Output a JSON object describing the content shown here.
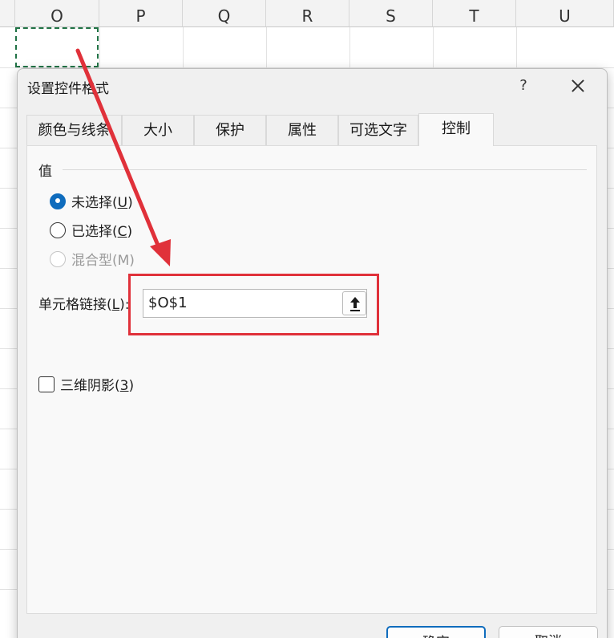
{
  "sheet": {
    "columns": [
      "O",
      "P",
      "Q",
      "R",
      "S",
      "T",
      "U"
    ]
  },
  "dialog": {
    "title": "设置控件格式",
    "help_label": "?",
    "tabs": [
      {
        "label": "颜色与线条"
      },
      {
        "label": "大小"
      },
      {
        "label": "保护"
      },
      {
        "label": "属性"
      },
      {
        "label": "可选文字"
      },
      {
        "label": "控制"
      }
    ],
    "active_tab": "控制",
    "value_group": {
      "label": "值",
      "options": [
        {
          "text": "未选择(",
          "key": "U",
          "close": ")",
          "checked": true,
          "disabled": false
        },
        {
          "text": "已选择(",
          "key": "C",
          "close": ")",
          "checked": false,
          "disabled": false
        },
        {
          "text": "混合型(M)",
          "key": "",
          "close": "",
          "checked": false,
          "disabled": true
        }
      ]
    },
    "cell_link": {
      "label_prefix": "单元格链接(",
      "label_key": "L",
      "label_suffix": "):",
      "value": "$O$1"
    },
    "shading_3d": {
      "label_prefix": "三维阴影(",
      "label_key": "3",
      "label_suffix": ")",
      "checked": false
    },
    "buttons": {
      "ok": "确定",
      "cancel": "取消"
    }
  },
  "colors": {
    "accent": "#0f6cbd",
    "annotation_red": "#e0313a",
    "selection_green": "#217346"
  }
}
